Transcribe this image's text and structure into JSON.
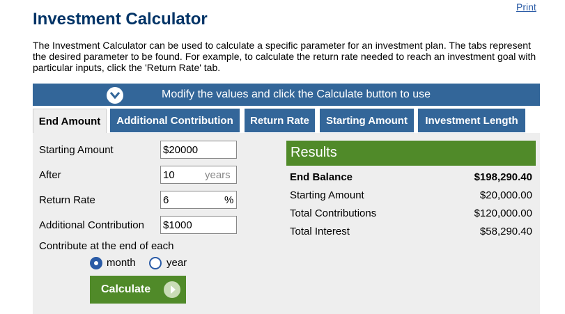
{
  "print_label": "Print",
  "title": "Investment Calculator",
  "intro": "The Investment Calculator can be used to calculate a specific parameter for an investment plan. The tabs represent the desired parameter to be found. For example, to calculate the return rate needed to reach an investment goal with particular inputs, click the 'Return Rate' tab.",
  "banner": "Modify the values and click the Calculate button to use",
  "tabs": [
    {
      "label": "End Amount",
      "active": true
    },
    {
      "label": "Additional Contribution",
      "active": false
    },
    {
      "label": "Return Rate",
      "active": false
    },
    {
      "label": "Starting Amount",
      "active": false
    },
    {
      "label": "Investment Length",
      "active": false
    }
  ],
  "form": {
    "starting_amount": {
      "label": "Starting Amount",
      "value": "$20000"
    },
    "after": {
      "label": "After",
      "value": "10",
      "unit": "years"
    },
    "return_rate": {
      "label": "Return Rate",
      "value": "6",
      "unit": "%"
    },
    "additional_contribution": {
      "label": "Additional Contribution",
      "value": "$1000"
    },
    "contribute_label": "Contribute at the end of each",
    "frequency": {
      "options": [
        "month",
        "year"
      ],
      "selected": "month"
    }
  },
  "calculate_label": "Calculate",
  "results": {
    "title": "Results",
    "rows": [
      {
        "label": "End Balance",
        "value": "$198,290.40",
        "bold": true
      },
      {
        "label": "Starting Amount",
        "value": "$20,000.00",
        "bold": false
      },
      {
        "label": "Total Contributions",
        "value": "$120,000.00",
        "bold": false
      },
      {
        "label": "Total Interest",
        "value": "$58,290.40",
        "bold": false
      }
    ]
  },
  "colors": {
    "primary_blue": "#336699",
    "accent_green": "#508a29",
    "title": "#003366",
    "panel": "#eeeeee"
  }
}
